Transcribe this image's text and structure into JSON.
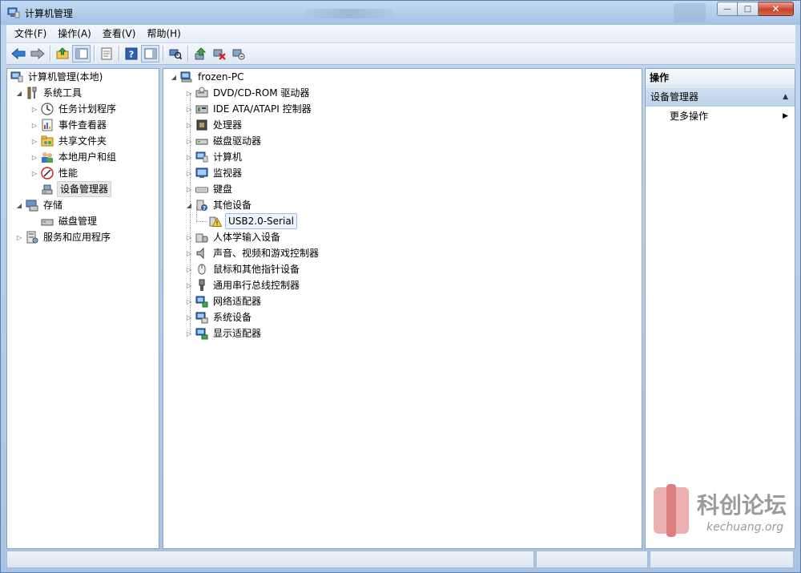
{
  "window": {
    "title": "计算机管理"
  },
  "menu": [
    "文件(F)",
    "操作(A)",
    "查看(V)",
    "帮助(H)"
  ],
  "toolbar": {
    "icons": [
      "back-arrow-icon",
      "forward-arrow-icon",
      "up-folder-icon",
      "show-hide-tree-icon",
      "properties-icon",
      "help-icon",
      "show-hide-action-icon",
      "scan-hardware-icon",
      "update-driver-icon",
      "uninstall-icon",
      "disable-device-icon"
    ]
  },
  "left_tree": {
    "root": "计算机管理(本地)",
    "system_tools": "系统工具",
    "task_scheduler": "任务计划程序",
    "event_viewer": "事件查看器",
    "shared_folders": "共享文件夹",
    "local_users": "本地用户和组",
    "performance": "性能",
    "device_manager": "设备管理器",
    "storage": "存储",
    "disk_management": "磁盘管理",
    "services_apps": "服务和应用程序"
  },
  "device_tree": {
    "root": "frozen-PC",
    "categories": [
      {
        "label": "DVD/CD-ROM 驱动器",
        "icon": "dvd-drive-icon"
      },
      {
        "label": "IDE ATA/ATAPI 控制器",
        "icon": "ide-controller-icon"
      },
      {
        "label": "处理器",
        "icon": "processor-icon"
      },
      {
        "label": "磁盘驱动器",
        "icon": "disk-drive-icon"
      },
      {
        "label": "计算机",
        "icon": "computer-icon"
      },
      {
        "label": "监视器",
        "icon": "monitor-icon"
      },
      {
        "label": "键盘",
        "icon": "keyboard-icon"
      },
      {
        "label": "其他设备",
        "icon": "unknown-device-icon"
      },
      {
        "label": "人体学输入设备",
        "icon": "hid-icon"
      },
      {
        "label": "声音、视频和游戏控制器",
        "icon": "speaker-icon"
      },
      {
        "label": "鼠标和其他指针设备",
        "icon": "mouse-icon"
      },
      {
        "label": "通用串行总线控制器",
        "icon": "usb-icon"
      },
      {
        "label": "网络适配器",
        "icon": "network-adapter-icon"
      },
      {
        "label": "系统设备",
        "icon": "system-device-icon"
      },
      {
        "label": "显示适配器",
        "icon": "display-adapter-icon"
      }
    ],
    "other_child": "USB2.0-Serial"
  },
  "actions": {
    "header": "操作",
    "section": "设备管理器",
    "more": "更多操作"
  },
  "watermark": {
    "text": "科创论坛",
    "url": "kechuang.org"
  }
}
